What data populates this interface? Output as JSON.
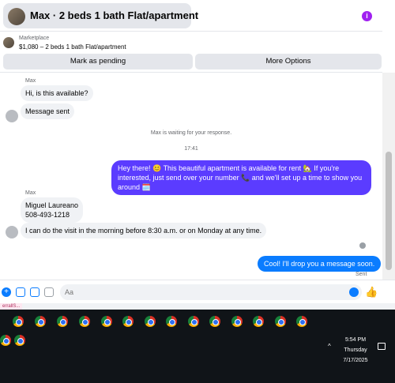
{
  "header": {
    "title": "Max · 2 beds 1 bath Flat/apartment",
    "info_icon": "info-icon",
    "accent": "#a020f0"
  },
  "marketplace": {
    "label": "Marketplace",
    "price_line": "$1,080 – 2 beds 1 bath Flat/apartment",
    "mark_pending_label": "Mark as pending",
    "more_options_label": "More Options"
  },
  "chat": {
    "sender_name_1": "Max",
    "msg_1": "Hi, is this available?",
    "msg_2": "Message sent",
    "waiting_note": "Max is waiting for your response.",
    "timestamp": "17:41",
    "out_msg_1": "Hey there! 😊 This beautiful apartment is available for rent 🏡 If you're interested, just send over your number 📞 and we'll set up a time to show you around 🗓️",
    "sender_name_2": "Max",
    "msg_3_line_1": "Miguel Laureano",
    "msg_3_line_2": "508-493-1218",
    "msg_4": "I can do the visit in the morning before 8:30 a.m. or on Monday at any time.",
    "out_msg_2": "Cool! I'll drop you a message soon.",
    "sent_label": "Sent",
    "out_color": "#5b3cff",
    "out_color_2": "#0a7cff"
  },
  "composer": {
    "placeholder": "Aa"
  },
  "tab": {
    "label": "errallS..."
  },
  "taskbar": {
    "time": "5:54 PM",
    "day": "Thursday",
    "date": "7/17/2025"
  }
}
